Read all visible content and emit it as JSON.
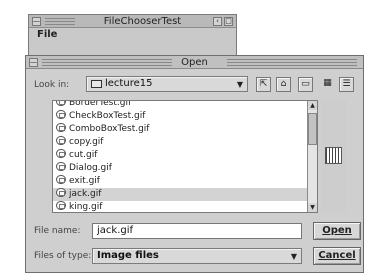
{
  "back_window": {
    "title": "FileChooserTest",
    "menu": "File"
  },
  "dialog": {
    "title": "Open",
    "look_in_label": "Look in:",
    "look_in_value": "lecture15",
    "files": [
      "BorderTest.gif",
      "CheckBoxTest.gif",
      "ComboBoxTest.gif",
      "copy.gif",
      "cut.gif",
      "Dialog.gif",
      "exit.gif",
      "jack.gif",
      "king.gif"
    ],
    "selected_file": "jack.gif",
    "file_name_label": "File name:",
    "file_name_value": "jack.gif",
    "files_of_type_label": "Files of type:",
    "files_of_type_value": "Image files",
    "open_label": "Open",
    "cancel_label": "Cancel",
    "toolbar_icons": [
      "up-folder-icon",
      "home-icon",
      "new-folder-icon",
      "list-view-icon",
      "details-view-icon"
    ]
  }
}
